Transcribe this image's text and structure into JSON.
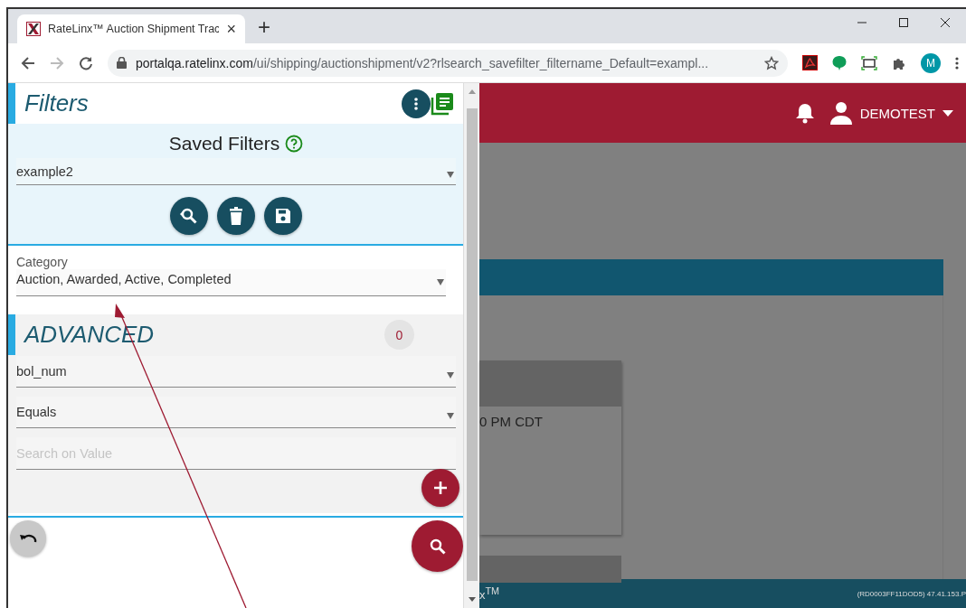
{
  "browser": {
    "tab": {
      "title": "RateLinx™ Auction Shipment Trac",
      "close": "×"
    },
    "new_tab": "+",
    "url_host": "portalqa.ratelinx.com",
    "url_path": "/ui/shipping/auctionshipment/v2?rlsearch_savefilter_filtername_Default=exampl...",
    "profile": "M"
  },
  "filters_panel": {
    "title": "Filters",
    "saved_filters": {
      "title": "Saved Filters",
      "selected": "example2"
    },
    "category": {
      "label": "Category",
      "value": "Auction, Awarded, Active, Completed"
    },
    "advanced": {
      "title": "ADVANCED",
      "count": "0",
      "field": "bol_num",
      "operator": "Equals",
      "value_placeholder": "Search on Value"
    }
  },
  "header": {
    "user": "DEMOTEST"
  },
  "background": {
    "card_text": "0 PM CDT",
    "footer_brand": "x$^{TM}$",
    "footer_info": "(RD0003FF11DOD5) 47.41.153.P"
  }
}
